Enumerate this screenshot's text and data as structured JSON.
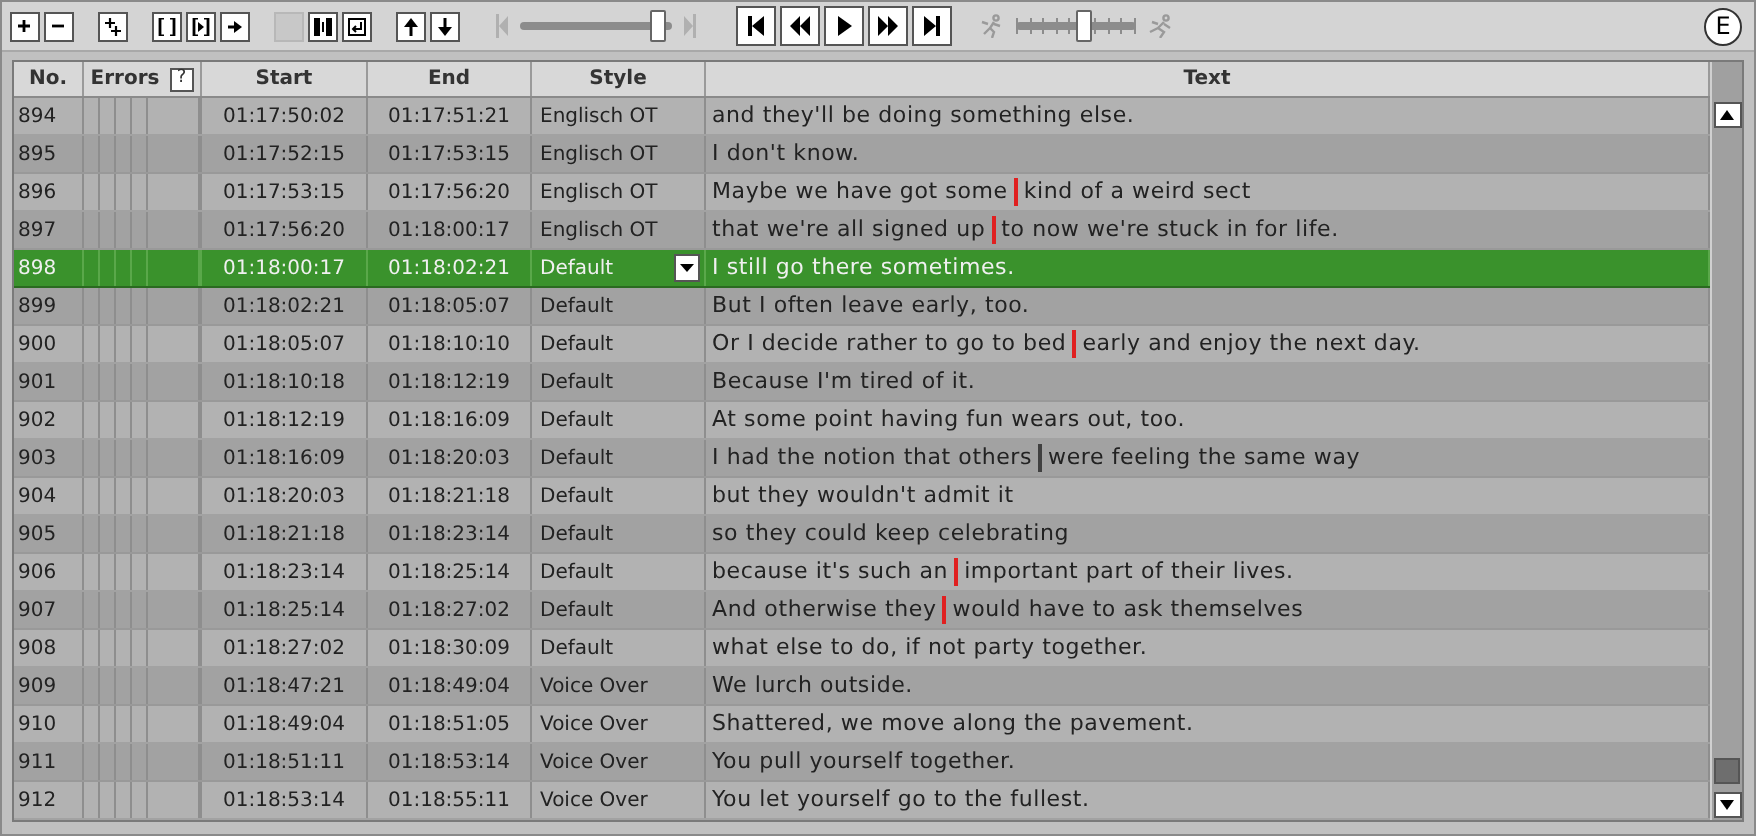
{
  "toolbar": [
    {
      "kind": "plus",
      "disabled": false
    },
    {
      "kind": "minus",
      "disabled": false
    },
    {
      "kind": "gap"
    },
    {
      "kind": "plus-sub",
      "disabled": false
    },
    {
      "kind": "gap"
    },
    {
      "kind": "brackets",
      "disabled": false
    },
    {
      "kind": "brackets-in",
      "disabled": false
    },
    {
      "kind": "arrow-right",
      "disabled": false
    },
    {
      "kind": "gap"
    },
    {
      "kind": "blank",
      "disabled": true
    },
    {
      "kind": "brackets-bold",
      "disabled": false
    },
    {
      "kind": "return",
      "disabled": false
    },
    {
      "kind": "gap"
    },
    {
      "kind": "up",
      "disabled": false
    },
    {
      "kind": "down",
      "disabled": false
    }
  ],
  "position_slider": {
    "level": 0.95
  },
  "transport": [
    {
      "kind": "first"
    },
    {
      "kind": "rewind"
    },
    {
      "kind": "play"
    },
    {
      "kind": "forward"
    },
    {
      "kind": "last"
    }
  ],
  "speed_slider": {
    "level": 0.58
  },
  "mode_badge": "E",
  "columns": {
    "no": "No.",
    "errors": "Errors",
    "errors_help": "?",
    "start": "Start",
    "end": "End",
    "style": "Style",
    "text": "Text"
  },
  "rows": [
    {
      "no": "894",
      "start": "01:17:50:02",
      "end": "01:17:51:21",
      "style": "Englisch OT",
      "text": [
        {
          "text": "and they'll be doing something else."
        }
      ],
      "selected": false
    },
    {
      "no": "895",
      "start": "01:17:52:15",
      "end": "01:17:53:15",
      "style": "Englisch OT",
      "text": [
        {
          "text": "I don't know."
        }
      ],
      "selected": false
    },
    {
      "no": "896",
      "start": "01:17:53:15",
      "end": "01:17:56:20",
      "style": "Englisch OT",
      "text": [
        {
          "text": "Maybe we have got some"
        },
        {
          "text": "kind of a weird sect",
          "color": "#e02020"
        }
      ],
      "selected": false
    },
    {
      "no": "897",
      "start": "01:17:56:20",
      "end": "01:18:00:17",
      "style": "Englisch OT",
      "text": [
        {
          "text": "that we're all signed up"
        },
        {
          "text": "to now we're stuck in for life.",
          "color": "#e02020"
        }
      ],
      "selected": false
    },
    {
      "no": "898",
      "start": "01:18:00:17",
      "end": "01:18:02:21",
      "style": "Default",
      "text": [
        {
          "text": "I still go there sometimes."
        }
      ],
      "selected": true
    },
    {
      "no": "899",
      "start": "01:18:02:21",
      "end": "01:18:05:07",
      "style": "Default",
      "text": [
        {
          "text": "But I often leave early, too."
        }
      ],
      "selected": false
    },
    {
      "no": "900",
      "start": "01:18:05:07",
      "end": "01:18:10:10",
      "style": "Default",
      "text": [
        {
          "text": "Or I decide rather to go to bed"
        },
        {
          "text": "early and enjoy the next day.",
          "color": "#e02020"
        }
      ],
      "selected": false
    },
    {
      "no": "901",
      "start": "01:18:10:18",
      "end": "01:18:12:19",
      "style": "Default",
      "text": [
        {
          "text": "Because I'm tired of it."
        }
      ],
      "selected": false
    },
    {
      "no": "902",
      "start": "01:18:12:19",
      "end": "01:18:16:09",
      "style": "Default",
      "text": [
        {
          "text": "At some point having fun wears out, too."
        }
      ],
      "selected": false
    },
    {
      "no": "903",
      "start": "01:18:16:09",
      "end": "01:18:20:03",
      "style": "Default",
      "text": [
        {
          "text": "I had the notion that others"
        },
        {
          "text": "were feeling the same way",
          "color": "#404040"
        }
      ],
      "selected": false
    },
    {
      "no": "904",
      "start": "01:18:20:03",
      "end": "01:18:21:18",
      "style": "Default",
      "text": [
        {
          "text": "but they wouldn't admit it"
        }
      ],
      "selected": false
    },
    {
      "no": "905",
      "start": "01:18:21:18",
      "end": "01:18:23:14",
      "style": "Default",
      "text": [
        {
          "text": "so they could keep celebrating"
        }
      ],
      "selected": false
    },
    {
      "no": "906",
      "start": "01:18:23:14",
      "end": "01:18:25:14",
      "style": "Default",
      "text": [
        {
          "text": "because it's such an"
        },
        {
          "text": "important part of their lives.",
          "color": "#e02020"
        }
      ],
      "selected": false
    },
    {
      "no": "907",
      "start": "01:18:25:14",
      "end": "01:18:27:02",
      "style": "Default",
      "text": [
        {
          "text": "And otherwise they"
        },
        {
          "text": "would have to ask themselves",
          "color": "#e02020"
        }
      ],
      "selected": false
    },
    {
      "no": "908",
      "start": "01:18:27:02",
      "end": "01:18:30:09",
      "style": "Default",
      "text": [
        {
          "text": "what else to do, if not party together."
        }
      ],
      "selected": false
    },
    {
      "no": "909",
      "start": "01:18:47:21",
      "end": "01:18:49:04",
      "style": "Voice Over",
      "text": [
        {
          "text": "We lurch outside."
        }
      ],
      "selected": false
    },
    {
      "no": "910",
      "start": "01:18:49:04",
      "end": "01:18:51:05",
      "style": "Voice Over",
      "text": [
        {
          "text": "Shattered, we move along the pavement."
        }
      ],
      "selected": false
    },
    {
      "no": "911",
      "start": "01:18:51:11",
      "end": "01:18:53:14",
      "style": "Voice Over",
      "text": [
        {
          "text": "You pull yourself together."
        }
      ],
      "selected": false
    },
    {
      "no": "912",
      "start": "01:18:53:14",
      "end": "01:18:55:11",
      "style": "Voice Over",
      "text": [
        {
          "text": "You let yourself go to the fullest."
        }
      ],
      "selected": false
    }
  ]
}
